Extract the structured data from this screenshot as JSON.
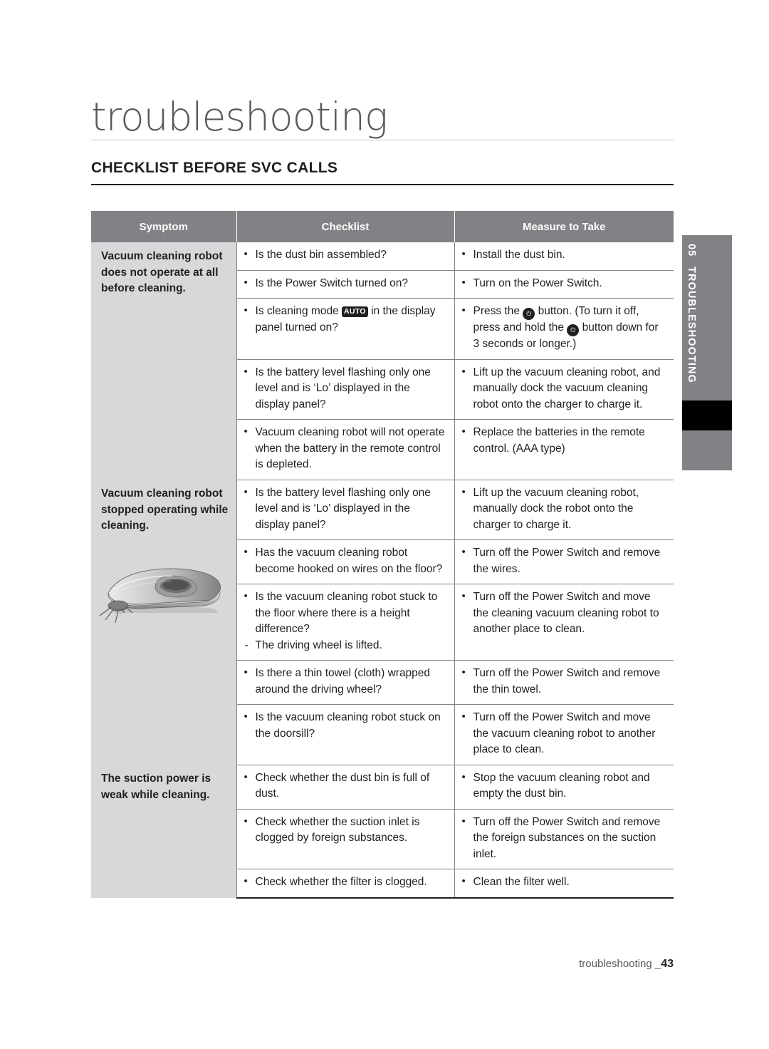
{
  "page": {
    "title": "troubleshooting",
    "section_heading": "CHECKLIST BEFORE SVC CALLS",
    "footer_text": "troubleshooting _",
    "footer_page": "43"
  },
  "side_tab": {
    "number": "05",
    "label": "TROUBLESHOOTING"
  },
  "table": {
    "headers": [
      "Symptom",
      "Checklist",
      "Measure to Take"
    ],
    "rows": [
      {
        "symptom": "Vacuum cleaning robot does not operate at all before cleaning.",
        "checklist": "Is the dust bin assembled?",
        "measure": "Install the dust bin."
      },
      {
        "symptom": "",
        "checklist": "Is the Power Switch turned on?",
        "measure": "Turn on the Power Switch."
      },
      {
        "symptom": "",
        "checklist_pre": "Is cleaning mode",
        "checklist_icon": "AUTO",
        "checklist_post": "in the display panel turned on?",
        "measure_pre": "Press the",
        "measure_icon_1": "power-icon",
        "measure_mid": "button. (To turn it off, press and hold the",
        "measure_icon_2": "power-icon",
        "measure_post": "button down for 3 seconds or longer.)"
      },
      {
        "symptom": "",
        "checklist": "Is the battery level flashing only one level and is ‘Lo’ displayed in the display panel?",
        "measure": "Lift up the vacuum cleaning robot, and manually dock the vacuum cleaning robot onto the charger to charge it."
      },
      {
        "symptom": "",
        "checklist": "Vacuum cleaning robot will not operate when the battery in the remote control is depleted.",
        "measure": "Replace the batteries in the remote control. (AAA type)"
      },
      {
        "symptom": "Vacuum cleaning robot stopped operating while cleaning.",
        "checklist": "Is the battery level flashing only one level and is ‘Lo’ displayed in the display panel?",
        "measure": "Lift up the vacuum cleaning robot, manually dock the robot onto the charger to charge it."
      },
      {
        "symptom": "",
        "checklist": "Has the vacuum cleaning robot become hooked on wires on the floor?",
        "measure": "Turn off the Power Switch and remove the wires."
      },
      {
        "symptom": "",
        "checklist": "Is the vacuum cleaning robot stuck to the floor where there is a height difference?",
        "checklist_dash": "The driving wheel is lifted.",
        "measure": "Turn off the Power Switch and move the cleaning vacuum cleaning robot to another place to clean."
      },
      {
        "symptom": "",
        "checklist": "Is there a thin towel (cloth) wrapped around the driving wheel?",
        "measure": "Turn off the Power Switch and remove the thin towel."
      },
      {
        "symptom": "",
        "checklist": "Is the vacuum cleaning robot stuck on the doorsill?",
        "measure": "Turn off the Power Switch and move the vacuum cleaning robot to another place to clean."
      },
      {
        "symptom": "The suction power is weak while cleaning.",
        "checklist": "Check whether the dust bin is full of dust.",
        "measure": "Stop the vacuum cleaning robot and empty the dust bin."
      },
      {
        "symptom": "",
        "checklist": "Check whether the suction inlet is clogged by foreign substances.",
        "measure": "Turn off the Power Switch and remove the foreign substances on the suction inlet."
      },
      {
        "symptom": "",
        "checklist": "Check whether the filter is clogged.",
        "measure": "Clean the filter well."
      }
    ]
  },
  "colors": {
    "header_gray": "#808285",
    "symptom_gray": "#d7d8da",
    "text": "#231f20",
    "title_gray": "#58595b"
  }
}
